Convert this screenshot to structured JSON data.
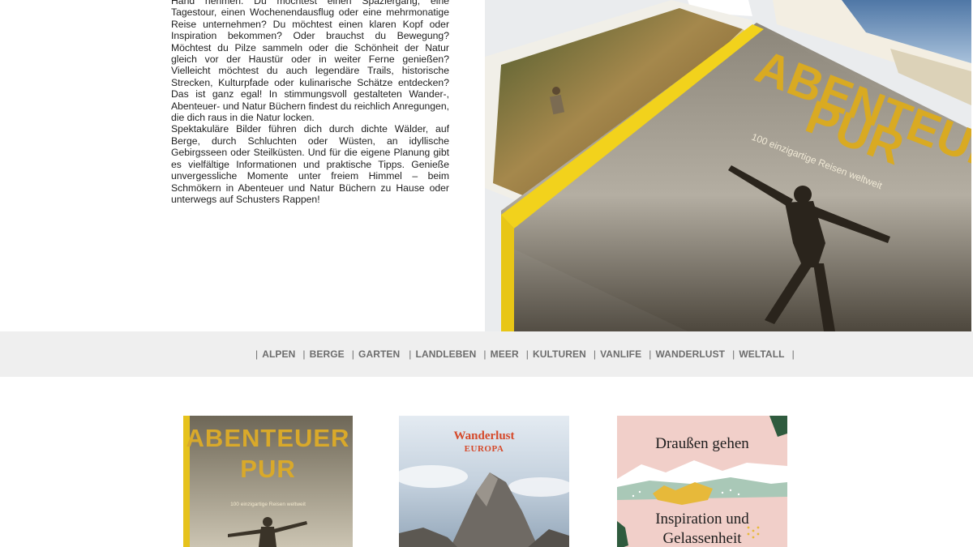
{
  "intro": {
    "paragraph1": "Hand nehmen. Du möchtest einen Spaziergang, eine Tagestour, einen Wochenendausflug oder eine mehrmonatige Reise unternehmen? Du möchtest einen klaren Kopf oder Inspiration bekommen? Oder brauchst du Bewegung? Möchtest du Pilze sammeln oder die Schönheit der Natur gleich vor der Haustür oder in weiter Ferne genießen? Vielleicht möchtest du auch legendäre Trails, historische Strecken, Kulturpfade oder kulinarische Schätze entdecken? Das ist ganz egal! In stimmungsvoll gestalteten Wander-, Abenteuer- und Natur Büchern findest du reichlich Anregungen, die dich raus in die Natur locken.",
    "paragraph2": "Spektakuläre Bilder führen dich durch dichte Wälder, auf Berge, durch Schluchten oder Wüsten, an idyllische Gebirgsseen oder Steilküsten. Und für die eigene Planung gibt es vielfältige Informationen und praktische Tipps. Genieße unvergessliche Momente unter freiem Himmel – beim Schmökern in Abenteuer und Natur Büchern zu Hause oder unterwegs auf Schusters Rappen!"
  },
  "hero": {
    "book_title_line1": "ABENTEUER",
    "book_title_line2": "PUR",
    "book_subtitle": "100 einzigartige Reisen weltweit"
  },
  "categories": {
    "separator": "|",
    "items": [
      "ALPEN",
      "BERGE",
      "GARTEN",
      "LANDLEBEN",
      "MEER",
      "KULTUREN",
      "VANLIFE",
      "WANDERLUST",
      "WELTALL"
    ]
  },
  "covers": [
    {
      "title_line1": "ABENTEUER",
      "title_line2": "PUR",
      "subtitle": "100 einzigartige Reisen weltweit"
    },
    {
      "title": "Wanderlust",
      "subtitle": "EUROPA"
    },
    {
      "title": "Draußen gehen",
      "subtitle_line1": "Inspiration und",
      "subtitle_line2": "Gelassenheit"
    }
  ],
  "colors": {
    "nav_background": "#efefef",
    "nav_text": "#6d6d6d",
    "body_text": "#1e1e1e",
    "accent_yellow": "#e6c21c",
    "wanderlust_red": "#d5492a"
  }
}
